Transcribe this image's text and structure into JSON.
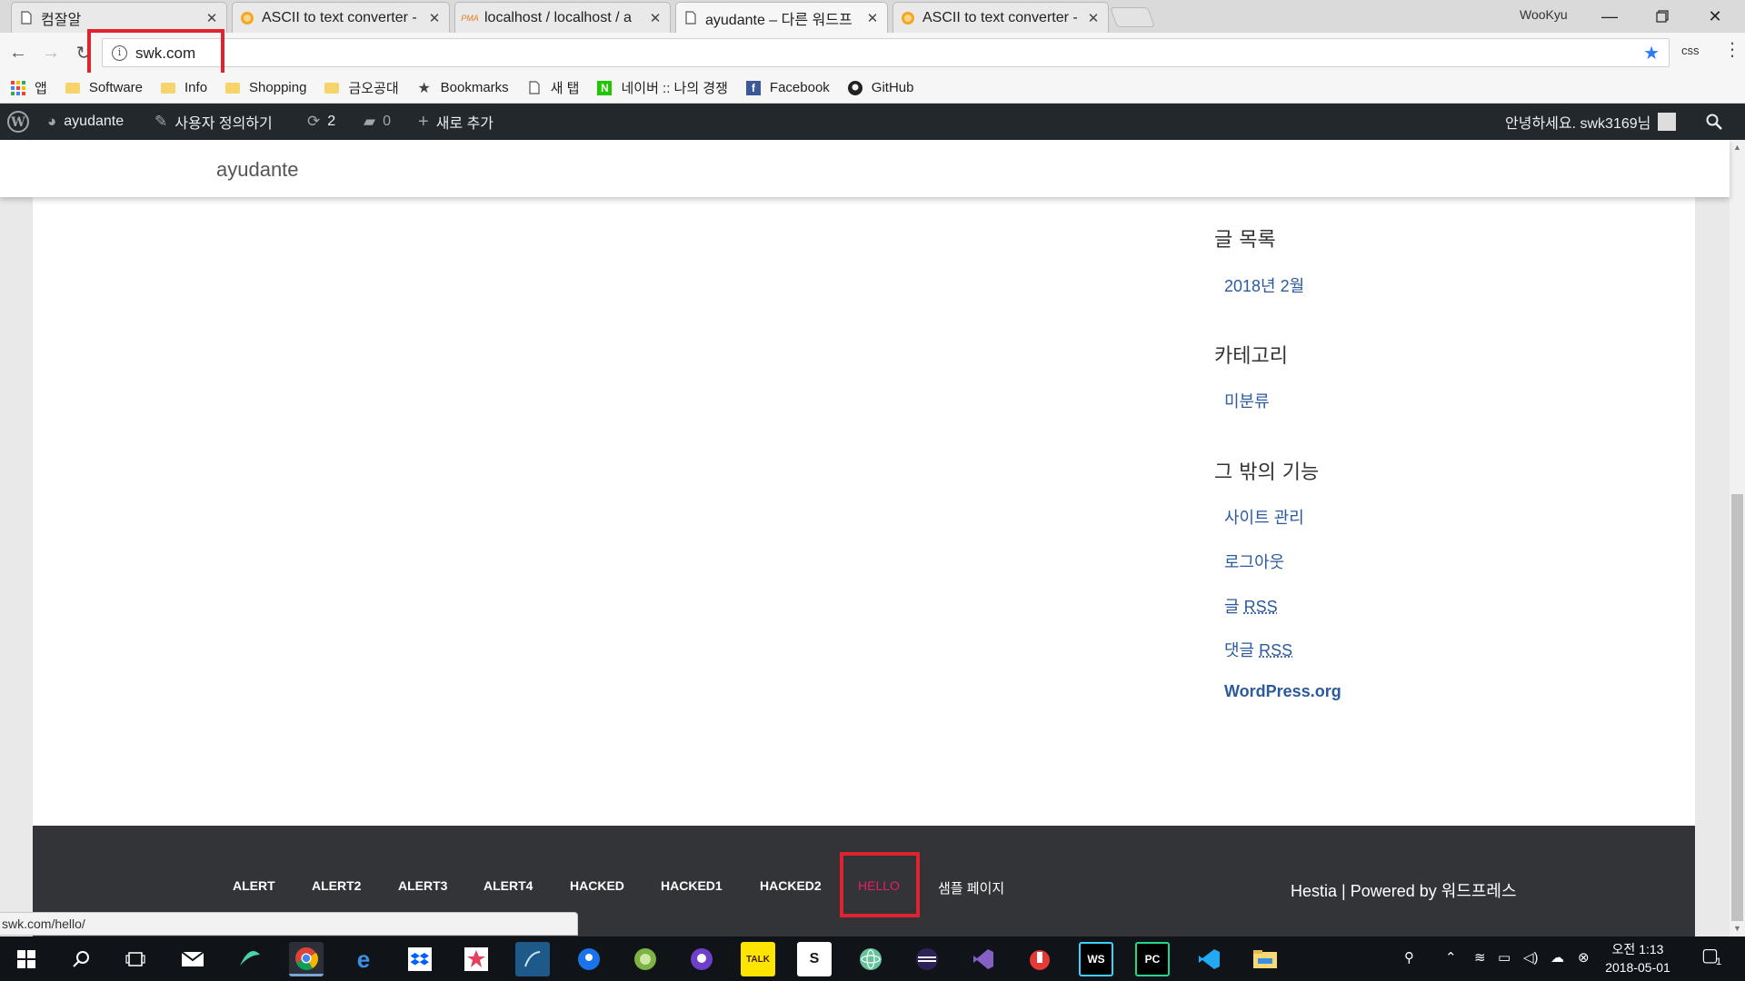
{
  "browser": {
    "tabs": [
      {
        "title": "컴잘알",
        "active": false
      },
      {
        "title": "ASCII to text converter -",
        "active": false
      },
      {
        "title": "localhost / localhost / a",
        "active": false
      },
      {
        "title": "ayudante – 다른 워드프",
        "active": true
      },
      {
        "title": "ASCII to text converter -",
        "active": false
      }
    ],
    "profile_name": "WooKyu",
    "url": "swk.com",
    "extension_label": "css",
    "bookmarks": [
      {
        "label": "앱",
        "icon": "apps-grid-icon"
      },
      {
        "label": "Software",
        "icon": "folder-icon"
      },
      {
        "label": "Info",
        "icon": "folder-icon"
      },
      {
        "label": "Shopping",
        "icon": "folder-icon"
      },
      {
        "label": "금오공대",
        "icon": "folder-icon"
      },
      {
        "label": "Bookmarks",
        "icon": "star-icon"
      },
      {
        "label": "새 탭",
        "icon": "page-icon"
      },
      {
        "label": "네이버 :: 나의 경쟁",
        "icon": "naver-icon"
      },
      {
        "label": "Facebook",
        "icon": "facebook-icon"
      },
      {
        "label": "GitHub",
        "icon": "github-icon"
      }
    ],
    "status_url": "swk.com/hello/"
  },
  "wp_admin_bar": {
    "site_name": "ayudante",
    "customize": "사용자 정의하기",
    "updates_count": "2",
    "comments_count": "0",
    "new_label": "새로 추가",
    "greeting": "안녕하세요. swk3169님"
  },
  "site": {
    "title": "ayudante",
    "sidebar": {
      "archives_title": "글 목록",
      "archives": [
        "2018년 2월"
      ],
      "categories_title": "카테고리",
      "categories": [
        "미분류"
      ],
      "meta_title": "그 밖의 기능",
      "meta": {
        "site_admin": "사이트 관리",
        "logout": "로그아웃",
        "posts_prefix": "글",
        "posts_rss": "RSS",
        "comments_prefix": "댓글",
        "comments_rss": "RSS",
        "wordpress_org": "WordPress.org"
      }
    },
    "footer_menu": [
      "ALERT",
      "ALERT2",
      "ALERT3",
      "ALERT4",
      "HACKED",
      "HACKED1",
      "HACKED2",
      "HELLO",
      "샘플 페이지"
    ],
    "footer_credit": "Hestia | Powered by 워드프레스"
  },
  "taskbar": {
    "clock_time": "오전 1:13",
    "clock_date": "2018-05-01",
    "notification_count": "1"
  },
  "colors": {
    "wp_admin_bar": "#23282d",
    "footer_bg": "#323437",
    "link": "#2c5a9e",
    "highlight_box": "#e0242d",
    "hello_link": "#e91e63"
  }
}
